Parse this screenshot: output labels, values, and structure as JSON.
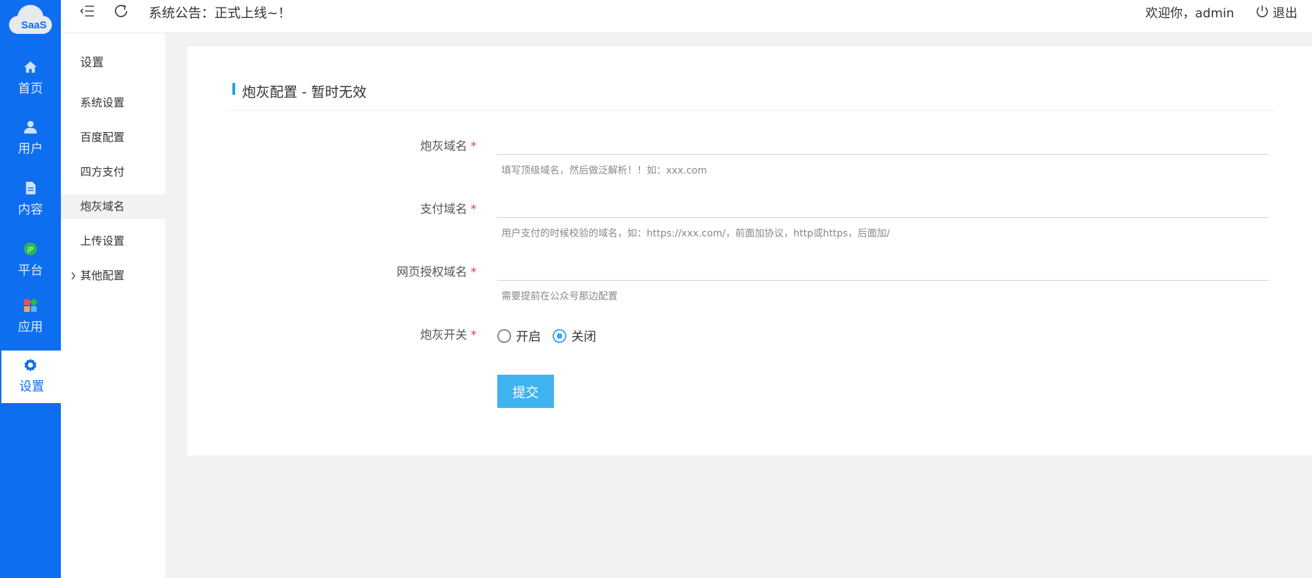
{
  "logo": {
    "text": "SaaS"
  },
  "rail": {
    "items": [
      {
        "label": "首页"
      },
      {
        "label": "用户"
      },
      {
        "label": "内容"
      },
      {
        "label": "平台"
      },
      {
        "label": "应用"
      },
      {
        "label": "设置"
      }
    ]
  },
  "header": {
    "notice": "系统公告：正式上线~！",
    "welcome": "欢迎你，admin",
    "logout_label": "退出"
  },
  "sub_sidebar": {
    "title": "设置",
    "items": [
      {
        "label": "系统设置"
      },
      {
        "label": "百度配置"
      },
      {
        "label": "四方支付"
      },
      {
        "label": "炮灰域名"
      },
      {
        "label": "上传设置"
      },
      {
        "label": "其他配置"
      }
    ]
  },
  "form": {
    "title": "炮灰配置 - 暂时无效",
    "fields": [
      {
        "label": "炮灰域名",
        "value": "",
        "hint": "填写顶级域名，然后做泛解析！！如：xxx.com"
      },
      {
        "label": "支付域名",
        "value": "",
        "hint": "用户支付的时候校验的域名，如：https://xxx.com/，前面加协议，http或https，后面加/"
      },
      {
        "label": "网页授权域名",
        "value": "",
        "hint": "需要提前在公众号那边配置"
      }
    ],
    "switch": {
      "label": "炮灰开关",
      "options": [
        {
          "label": "开启"
        },
        {
          "label": "关闭"
        }
      ],
      "selected": "关闭"
    },
    "required_mark": "*",
    "submit_label": "提交"
  },
  "colors": {
    "rail_bg": "#0d6ef0",
    "accent": "#3fb3ef",
    "required": "#e53935"
  }
}
